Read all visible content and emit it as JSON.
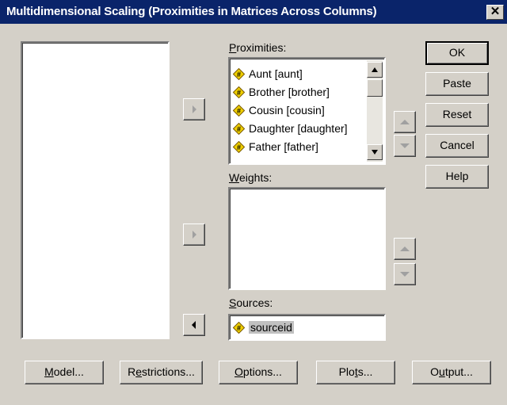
{
  "window": {
    "title": "Multidimensional Scaling (Proximities in Matrices Across Columns)",
    "close_glyph": "✕"
  },
  "proximities": {
    "label_u": "P",
    "label_rest": "roximities:",
    "items": [
      {
        "label": "Aunt [aunt]"
      },
      {
        "label": "Brother [brother]"
      },
      {
        "label": "Cousin [cousin]"
      },
      {
        "label": "Daughter [daughter]"
      },
      {
        "label": "Father [father]"
      }
    ]
  },
  "weights": {
    "label_u": "W",
    "label_rest": "eights:"
  },
  "sources": {
    "label_u": "S",
    "label_rest": "ources:",
    "value": "sourceid"
  },
  "side_buttons": {
    "ok": "OK",
    "paste": "Paste",
    "reset": "Reset",
    "cancel": "Cancel",
    "help": "Help"
  },
  "bottom_buttons": {
    "model": {
      "u": "M",
      "rest": "odel..."
    },
    "restrictions": {
      "pre": "R",
      "u": "e",
      "rest": "strictions..."
    },
    "options": {
      "u": "O",
      "rest": "ptions..."
    },
    "plots": {
      "pre": "Plo",
      "u": "t",
      "rest": "s..."
    },
    "output": {
      "pre": "O",
      "u": "u",
      "rest": "tput..."
    }
  },
  "icons": {
    "variable": "numeric-variable-icon",
    "move_right": "arrow-right-icon",
    "move_left": "arrow-left-icon",
    "up": "arrow-up-icon",
    "down": "arrow-down-icon"
  },
  "colors": {
    "title_bar": "#0a246a",
    "face": "#d4d0c8",
    "icon_yellow": "#f0d000"
  }
}
